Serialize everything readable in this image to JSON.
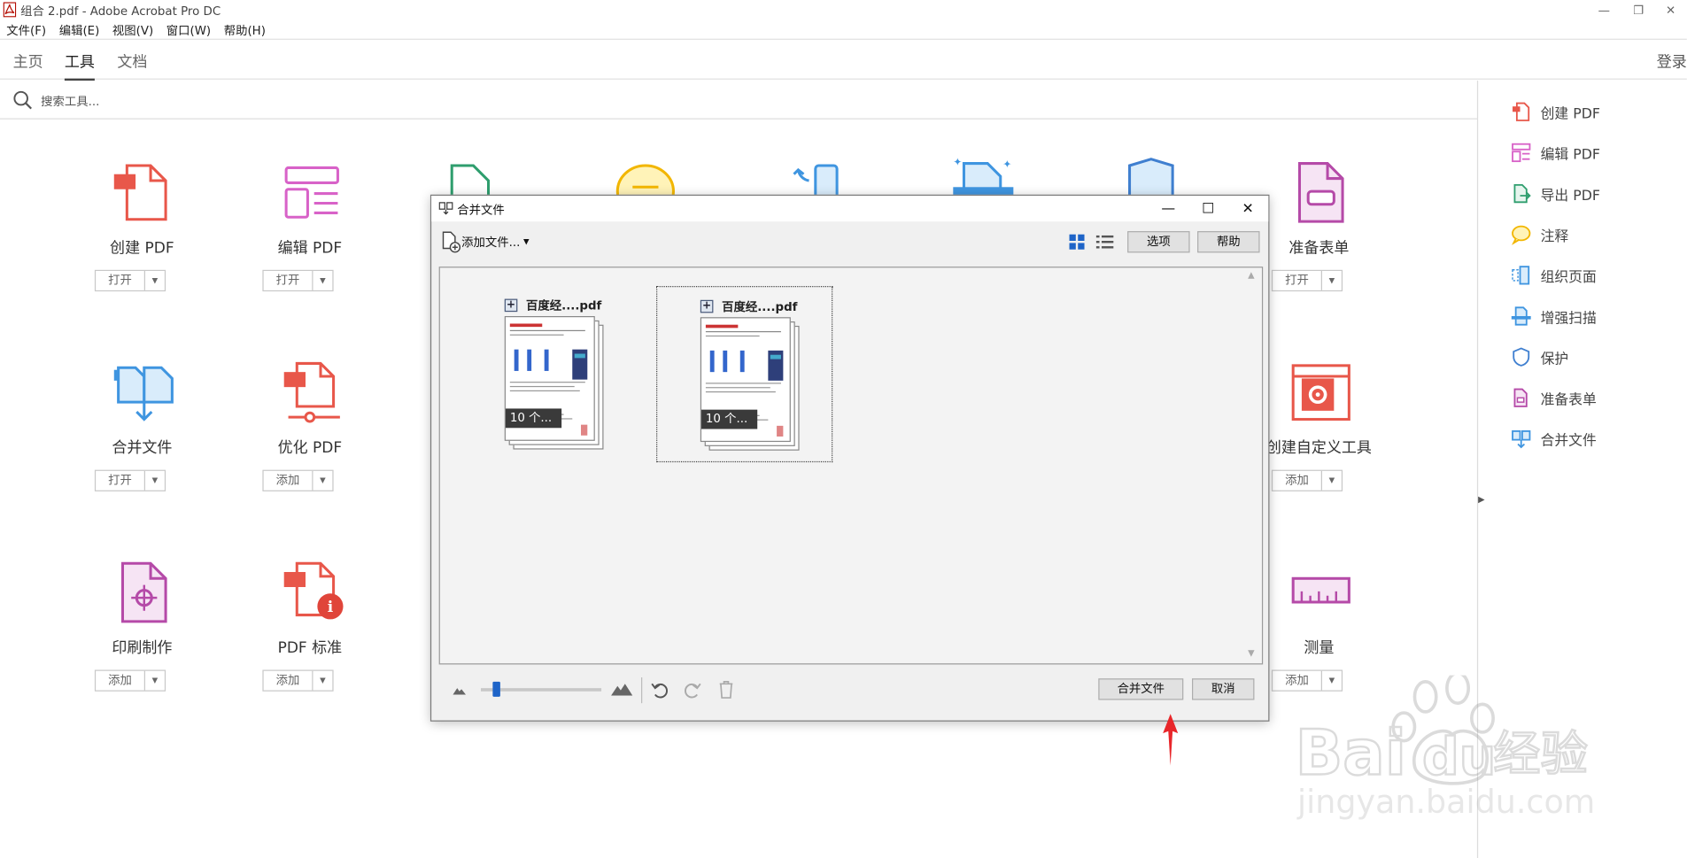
{
  "window": {
    "title": "组合 2.pdf - Adobe Acrobat Pro DC",
    "minimize": "—",
    "restore": "❐",
    "close": "✕"
  },
  "menu": [
    "文件(F)",
    "编辑(E)",
    "视图(V)",
    "窗口(W)",
    "帮助(H)"
  ],
  "tabs": {
    "home": "主页",
    "tools": "工具",
    "document": "文档",
    "login": "登录"
  },
  "search": {
    "placeholder": "搜索工具..."
  },
  "tools": [
    {
      "name": "创建 PDF",
      "button": "打开",
      "icon": "create-pdf-icon"
    },
    {
      "name": "编辑 PDF",
      "button": "打开",
      "icon": "edit-pdf-icon"
    },
    {
      "name": "合并文件",
      "button": "打开",
      "icon": "combine-files-icon"
    },
    {
      "name": "优化 PDF",
      "button": "添加",
      "icon": "optimize-pdf-icon"
    },
    {
      "name": "印刷制作",
      "button": "添加",
      "icon": "print-production-icon"
    },
    {
      "name": "PDF 标准",
      "button": "添加",
      "icon": "pdf-standards-icon"
    },
    {
      "name": "准备表单",
      "button": "打开",
      "icon": "prepare-form-icon"
    },
    {
      "name": "创建自定义工具",
      "button": "添加",
      "icon": "custom-tool-icon"
    },
    {
      "name": "测量",
      "button": "添加",
      "icon": "measure-icon"
    }
  ],
  "right_panel": [
    {
      "label": "创建 PDF",
      "icon": "create-pdf-icon",
      "color": "#e8574a"
    },
    {
      "label": "编辑 PDF",
      "icon": "edit-pdf-icon",
      "color": "#d862c8"
    },
    {
      "label": "导出 PDF",
      "icon": "export-pdf-icon",
      "color": "#2f9e6e"
    },
    {
      "label": "注释",
      "icon": "comment-icon",
      "color": "#f2b600"
    },
    {
      "label": "组织页面",
      "icon": "organize-pages-icon",
      "color": "#3f95e0"
    },
    {
      "label": "增强扫描",
      "icon": "enhance-scan-icon",
      "color": "#3f95e0"
    },
    {
      "label": "保护",
      "icon": "protect-icon",
      "color": "#3f7fd0"
    },
    {
      "label": "准备表单",
      "icon": "prepare-form-icon",
      "color": "#b54aa8"
    },
    {
      "label": "合并文件",
      "icon": "combine-files-icon",
      "color": "#3f95e0"
    }
  ],
  "dialog": {
    "title": "合并文件",
    "add_files": "添加文件...",
    "options": "选项",
    "help": "帮助",
    "files": [
      {
        "name": "百度经....pdf",
        "pages": "10 个..."
      },
      {
        "name": "百度经....pdf",
        "pages": "10 个..."
      }
    ],
    "zoom_level": 0.1,
    "combine": "合并文件",
    "cancel": "取消"
  },
  "watermark": {
    "logo": "Baidu经验",
    "url": "jingyan.baidu.com"
  },
  "colors": {
    "accent": "#1e64c8",
    "annotation_arrow": "#e8262a",
    "selected_icon": "#1e64c8"
  }
}
